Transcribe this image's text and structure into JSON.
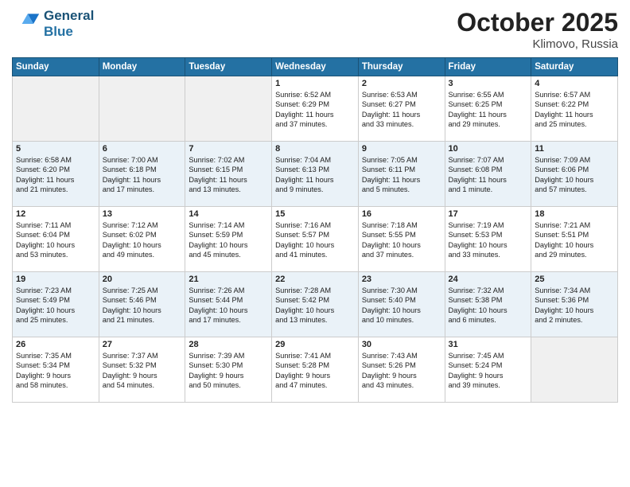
{
  "header": {
    "logo_line1": "General",
    "logo_line2": "Blue",
    "month": "October 2025",
    "location": "Klimovo, Russia"
  },
  "weekdays": [
    "Sunday",
    "Monday",
    "Tuesday",
    "Wednesday",
    "Thursday",
    "Friday",
    "Saturday"
  ],
  "weeks": [
    [
      {
        "day": "",
        "info": ""
      },
      {
        "day": "",
        "info": ""
      },
      {
        "day": "",
        "info": ""
      },
      {
        "day": "1",
        "info": "Sunrise: 6:52 AM\nSunset: 6:29 PM\nDaylight: 11 hours\nand 37 minutes."
      },
      {
        "day": "2",
        "info": "Sunrise: 6:53 AM\nSunset: 6:27 PM\nDaylight: 11 hours\nand 33 minutes."
      },
      {
        "day": "3",
        "info": "Sunrise: 6:55 AM\nSunset: 6:25 PM\nDaylight: 11 hours\nand 29 minutes."
      },
      {
        "day": "4",
        "info": "Sunrise: 6:57 AM\nSunset: 6:22 PM\nDaylight: 11 hours\nand 25 minutes."
      }
    ],
    [
      {
        "day": "5",
        "info": "Sunrise: 6:58 AM\nSunset: 6:20 PM\nDaylight: 11 hours\nand 21 minutes."
      },
      {
        "day": "6",
        "info": "Sunrise: 7:00 AM\nSunset: 6:18 PM\nDaylight: 11 hours\nand 17 minutes."
      },
      {
        "day": "7",
        "info": "Sunrise: 7:02 AM\nSunset: 6:15 PM\nDaylight: 11 hours\nand 13 minutes."
      },
      {
        "day": "8",
        "info": "Sunrise: 7:04 AM\nSunset: 6:13 PM\nDaylight: 11 hours\nand 9 minutes."
      },
      {
        "day": "9",
        "info": "Sunrise: 7:05 AM\nSunset: 6:11 PM\nDaylight: 11 hours\nand 5 minutes."
      },
      {
        "day": "10",
        "info": "Sunrise: 7:07 AM\nSunset: 6:08 PM\nDaylight: 11 hours\nand 1 minute."
      },
      {
        "day": "11",
        "info": "Sunrise: 7:09 AM\nSunset: 6:06 PM\nDaylight: 10 hours\nand 57 minutes."
      }
    ],
    [
      {
        "day": "12",
        "info": "Sunrise: 7:11 AM\nSunset: 6:04 PM\nDaylight: 10 hours\nand 53 minutes."
      },
      {
        "day": "13",
        "info": "Sunrise: 7:12 AM\nSunset: 6:02 PM\nDaylight: 10 hours\nand 49 minutes."
      },
      {
        "day": "14",
        "info": "Sunrise: 7:14 AM\nSunset: 5:59 PM\nDaylight: 10 hours\nand 45 minutes."
      },
      {
        "day": "15",
        "info": "Sunrise: 7:16 AM\nSunset: 5:57 PM\nDaylight: 10 hours\nand 41 minutes."
      },
      {
        "day": "16",
        "info": "Sunrise: 7:18 AM\nSunset: 5:55 PM\nDaylight: 10 hours\nand 37 minutes."
      },
      {
        "day": "17",
        "info": "Sunrise: 7:19 AM\nSunset: 5:53 PM\nDaylight: 10 hours\nand 33 minutes."
      },
      {
        "day": "18",
        "info": "Sunrise: 7:21 AM\nSunset: 5:51 PM\nDaylight: 10 hours\nand 29 minutes."
      }
    ],
    [
      {
        "day": "19",
        "info": "Sunrise: 7:23 AM\nSunset: 5:49 PM\nDaylight: 10 hours\nand 25 minutes."
      },
      {
        "day": "20",
        "info": "Sunrise: 7:25 AM\nSunset: 5:46 PM\nDaylight: 10 hours\nand 21 minutes."
      },
      {
        "day": "21",
        "info": "Sunrise: 7:26 AM\nSunset: 5:44 PM\nDaylight: 10 hours\nand 17 minutes."
      },
      {
        "day": "22",
        "info": "Sunrise: 7:28 AM\nSunset: 5:42 PM\nDaylight: 10 hours\nand 13 minutes."
      },
      {
        "day": "23",
        "info": "Sunrise: 7:30 AM\nSunset: 5:40 PM\nDaylight: 10 hours\nand 10 minutes."
      },
      {
        "day": "24",
        "info": "Sunrise: 7:32 AM\nSunset: 5:38 PM\nDaylight: 10 hours\nand 6 minutes."
      },
      {
        "day": "25",
        "info": "Sunrise: 7:34 AM\nSunset: 5:36 PM\nDaylight: 10 hours\nand 2 minutes."
      }
    ],
    [
      {
        "day": "26",
        "info": "Sunrise: 7:35 AM\nSunset: 5:34 PM\nDaylight: 9 hours\nand 58 minutes."
      },
      {
        "day": "27",
        "info": "Sunrise: 7:37 AM\nSunset: 5:32 PM\nDaylight: 9 hours\nand 54 minutes."
      },
      {
        "day": "28",
        "info": "Sunrise: 7:39 AM\nSunset: 5:30 PM\nDaylight: 9 hours\nand 50 minutes."
      },
      {
        "day": "29",
        "info": "Sunrise: 7:41 AM\nSunset: 5:28 PM\nDaylight: 9 hours\nand 47 minutes."
      },
      {
        "day": "30",
        "info": "Sunrise: 7:43 AM\nSunset: 5:26 PM\nDaylight: 9 hours\nand 43 minutes."
      },
      {
        "day": "31",
        "info": "Sunrise: 7:45 AM\nSunset: 5:24 PM\nDaylight: 9 hours\nand 39 minutes."
      },
      {
        "day": "",
        "info": ""
      }
    ]
  ]
}
